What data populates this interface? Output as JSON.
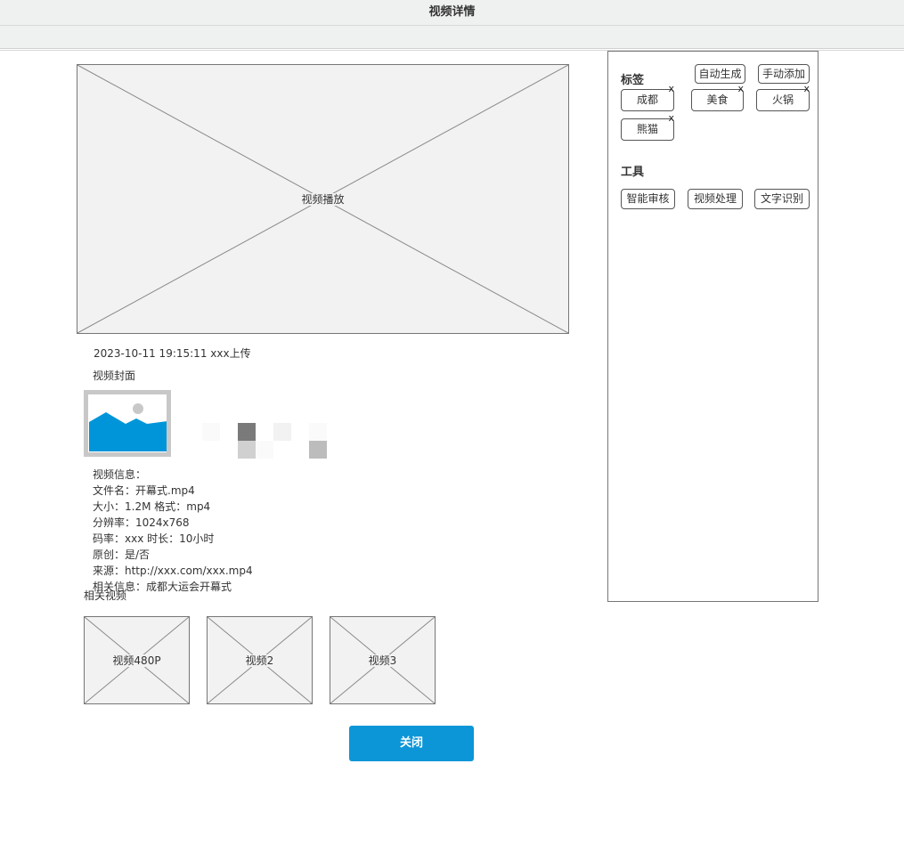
{
  "window": {
    "title": "视频详情"
  },
  "player": {
    "label": "视频播放"
  },
  "upload_info": "2023-10-11 19:15:11  xxx上传",
  "cover": {
    "title": "视频封面"
  },
  "video_info": {
    "heading": "视频信息：",
    "filename": "文件名：开幕式.mp4",
    "size_format": "大小：1.2M  格式：mp4",
    "resolution": "分辨率：1024x768",
    "bitrate_duration": "码率：xxx  时长：10小时",
    "original": "原创：是/否",
    "source": "来源：http://xxx.com/xxx.mp4",
    "related_info": "相关信息：成都大运会开幕式"
  },
  "related": {
    "title": "相关视频",
    "items": [
      {
        "label": "视频480P"
      },
      {
        "label": "视频2"
      },
      {
        "label": "视频3"
      }
    ]
  },
  "close_label": "关闭",
  "side_panel": {
    "tags_title": "标签",
    "auto_generate": "自动生成",
    "manual_add": "手动添加",
    "remove_mark": "x",
    "tags": [
      "成都",
      "美食",
      "火锅",
      "熊猫"
    ],
    "tools_title": "工具",
    "tools": [
      "智能审核",
      "视频处理",
      "文字识别"
    ]
  },
  "colors": {
    "accent": "#0c96d8",
    "image_icon": "#0095d9",
    "placeholder_bg": "#f2f2f2"
  }
}
